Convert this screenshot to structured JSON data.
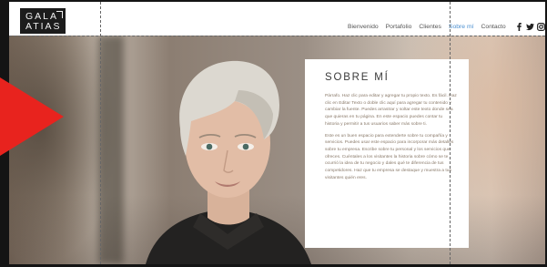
{
  "logo": {
    "line1": "GALA",
    "line2": "ATIAS"
  },
  "nav": {
    "items": [
      {
        "label": "Bienvenido",
        "active": false
      },
      {
        "label": "Portafolio",
        "active": false
      },
      {
        "label": "Clientes",
        "active": false
      },
      {
        "label": "Sobre mí",
        "active": true
      },
      {
        "label": "Contacto",
        "active": false
      }
    ],
    "social_icons": [
      "facebook-icon",
      "twitter-icon",
      "instagram-icon"
    ]
  },
  "about": {
    "title": "SOBRE MÍ",
    "paragraph1": "Párrafo. Haz clic para editar y agregar tu propio texto. Es fácil. Haz clic en Editar Texto o doble clic aquí para agregar tu contenido y cambiar la fuente. Puedes arrastrar y soltar este texto donde sea que quieras en tu página. En este espacio puedes contar tu historia y permitir a tus usuarios saber más sobre ti.",
    "paragraph2": "Este es un buen espacio para extenderte sobre tu compañía y servicios. Puedes usar este espacio para incorporar más detalles sobre tu empresa. Escribe sobre tu personal y los servicios que ofreces. Cuéntales a los visitantes la historia sobre cómo se te ocurrió la idea de tu negocio y dales qué te diferencia de tus competidores. Haz que tu empresa se destaque y muestra a tus visitantes quién eres."
  },
  "colors": {
    "accent_nav": "#4a8fd0",
    "arrow": "#e8231e",
    "logo_bg": "#1c1c1c"
  }
}
